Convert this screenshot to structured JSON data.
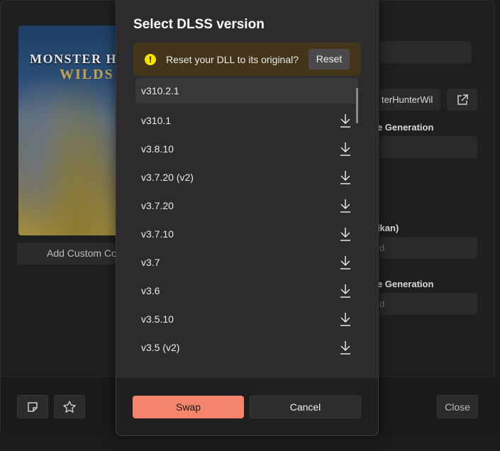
{
  "background": {
    "cover_logo_line1": "MONSTER HU",
    "cover_logo_line2": "WILDS",
    "add_cover_label": "Add Custom Co",
    "path_value": "terHunterWil",
    "frame_gen_label_1": "ne Generation",
    "vulkan_label": "ulkan)",
    "field_placeholder_1": "d",
    "frame_gen_label_2": "ne Generation",
    "field_placeholder_2": "d",
    "close_label": "Close",
    "footer_icons": [
      "note-icon",
      "star-icon"
    ]
  },
  "dialog": {
    "title": "Select DLSS version",
    "infobar": {
      "icon": "warning-icon",
      "text": "Reset your DLL to its original?",
      "reset_label": "Reset",
      "color": "#433519"
    },
    "versions": [
      {
        "label": "v310.2.1",
        "selected": true,
        "downloadable": false
      },
      {
        "label": "v310.1",
        "selected": false,
        "downloadable": true
      },
      {
        "label": "v3.8.10",
        "selected": false,
        "downloadable": true
      },
      {
        "label": "v3.7.20 (v2)",
        "selected": false,
        "downloadable": true
      },
      {
        "label": "v3.7.20",
        "selected": false,
        "downloadable": true
      },
      {
        "label": "v3.7.10",
        "selected": false,
        "downloadable": true
      },
      {
        "label": "v3.7",
        "selected": false,
        "downloadable": true
      },
      {
        "label": "v3.6",
        "selected": false,
        "downloadable": true
      },
      {
        "label": "v3.5.10",
        "selected": false,
        "downloadable": true
      },
      {
        "label": "v3.5 (v2)",
        "selected": false,
        "downloadable": true
      }
    ],
    "swap_label": "Swap",
    "cancel_label": "Cancel",
    "accent_color": "#f4846b"
  }
}
